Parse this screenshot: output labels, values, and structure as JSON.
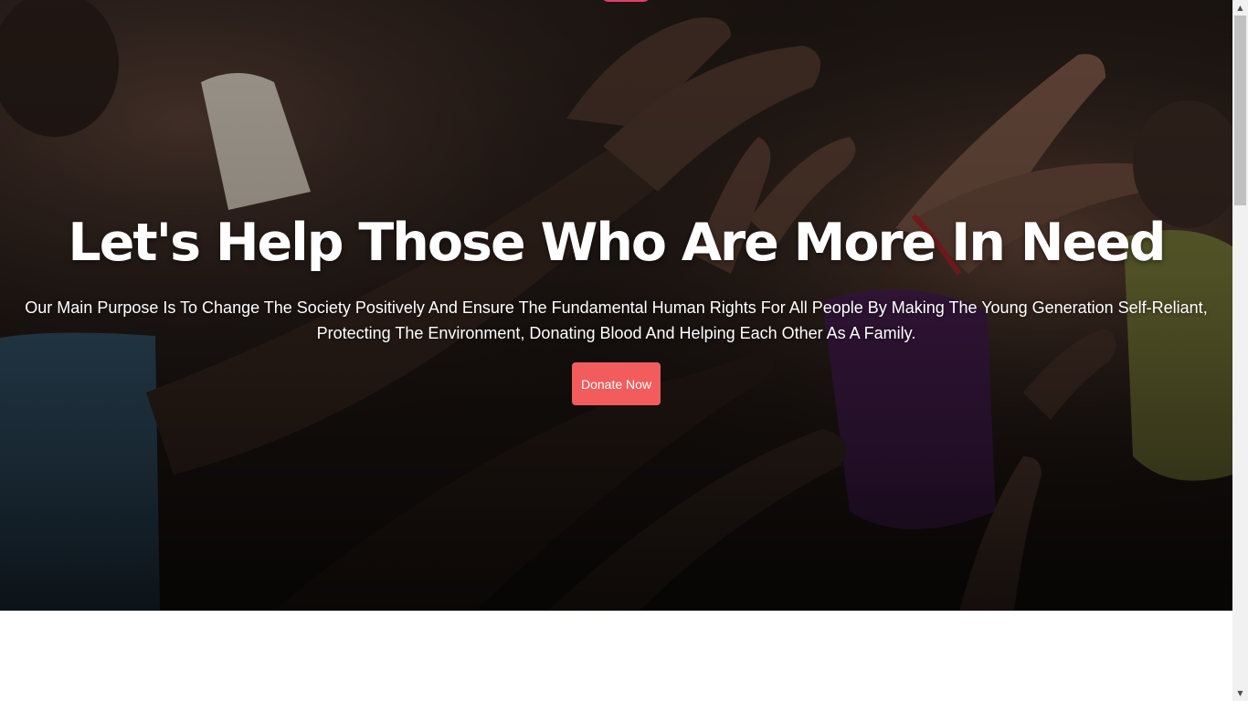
{
  "hero": {
    "title": "Let's Help Those Who Are More In Need",
    "subtitle": "Our Main Purpose Is To Change The Society Positively And Ensure The Fundamental Human Rights For All People By Making The Young Generation Self-Reliant, Protecting The Environment, Donating Blood And Helping Each Other As A Family.",
    "donate_label": "Donate Now"
  },
  "colors": {
    "accent": "#f25c5c",
    "top_accent": "#e83a6b"
  },
  "scrollbar": {
    "up_icon": "▲",
    "down_icon": "▼"
  }
}
